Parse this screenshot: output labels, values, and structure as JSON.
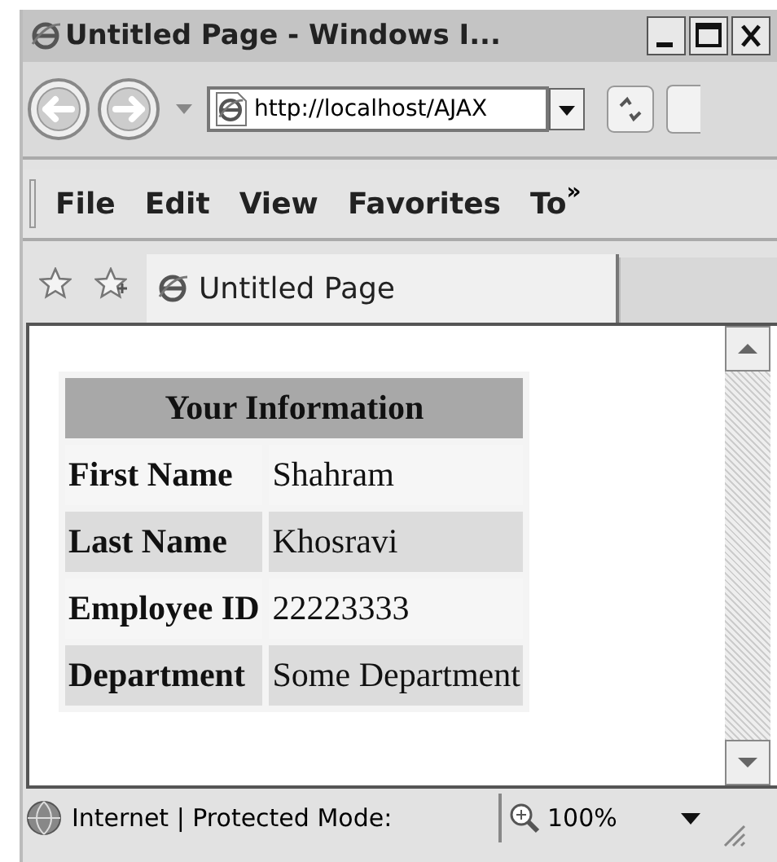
{
  "window": {
    "title": "Untitled Page - Windows I..."
  },
  "address_bar": {
    "value": "http://localhost/AJAX"
  },
  "menu_bar": {
    "items": [
      "File",
      "Edit",
      "View",
      "Favorites",
      "To"
    ],
    "overflow": "»"
  },
  "tabs": [
    {
      "label": "Untitled Page",
      "selected": true
    }
  ],
  "table": {
    "title": "Your Information",
    "rows": [
      {
        "label": "First Name",
        "value": "Shahram"
      },
      {
        "label": "Last Name",
        "value": "Khosravi"
      },
      {
        "label": "Employee ID",
        "value": "22223333"
      },
      {
        "label": "Department",
        "value": "Some Department"
      }
    ]
  },
  "status_bar": {
    "zone": "Internet | Protected Mode:",
    "zoom": "100%"
  }
}
